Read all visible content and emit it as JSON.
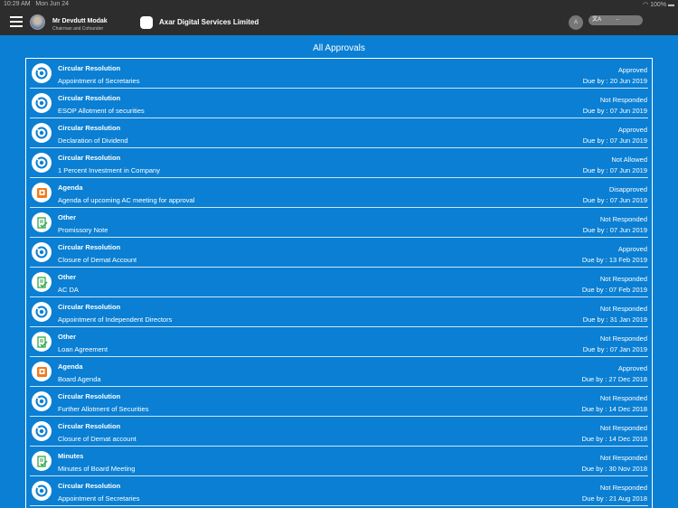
{
  "status_bar": {
    "time": "10:29 AM",
    "date": "Mon Jun 24",
    "battery": "100%"
  },
  "header": {
    "user_name": "Mr Devdutt Modak",
    "user_role": "Chairman and Cofounder",
    "company": "Axar Digital Services Limited",
    "avatar_letter": "A",
    "language_value": "--"
  },
  "page_title": "All Approvals",
  "items": [
    {
      "type": "Circular Resolution",
      "icon": "circular",
      "title": "Appointment of Secretaries",
      "status": "Approved",
      "due": "Due by : 20 Jun 2019"
    },
    {
      "type": "Circular Resolution",
      "icon": "circular",
      "title": "ESOP Allotment of securities",
      "status": "Not Responded",
      "due": "Due by : 07 Jun 2019"
    },
    {
      "type": "Circular Resolution",
      "icon": "circular",
      "title": "Declaration of Dividend",
      "status": "Approved",
      "due": "Due by : 07 Jun 2019"
    },
    {
      "type": "Circular Resolution",
      "icon": "circular",
      "title": "1 Percent Investment in Company",
      "status": "Not Allowed",
      "due": "Due by : 07 Jun 2019"
    },
    {
      "type": "Agenda",
      "icon": "agenda",
      "title": "Agenda of upcoming AC meeting for approval",
      "status": "Disapproved",
      "due": "Due by : 07 Jun 2019"
    },
    {
      "type": "Other",
      "icon": "other",
      "title": "Promissory Note",
      "status": "Not Responded",
      "due": "Due by : 07 Jun 2019"
    },
    {
      "type": "Circular Resolution",
      "icon": "circular",
      "title": "Closure of Demat Account",
      "status": "Approved",
      "due": "Due by : 13 Feb 2019"
    },
    {
      "type": "Other",
      "icon": "other",
      "title": "AC DA",
      "status": "Not Responded",
      "due": "Due by : 07 Feb 2019"
    },
    {
      "type": "Circular Resolution",
      "icon": "circular",
      "title": "Appointment of Independent Directors",
      "status": "Not Responded",
      "due": "Due by : 31 Jan 2019"
    },
    {
      "type": "Other",
      "icon": "other",
      "title": "Loan Agreement",
      "status": "Not Responded",
      "due": "Due by : 07 Jan 2019"
    },
    {
      "type": "Agenda",
      "icon": "agenda",
      "title": "Board Agenda",
      "status": "Approved",
      "due": "Due by : 27 Dec 2018"
    },
    {
      "type": "Circular Resolution",
      "icon": "circular",
      "title": "Further Allotment of Securities",
      "status": "Not Responded",
      "due": "Due by : 14 Dec 2018"
    },
    {
      "type": "Circular Resolution",
      "icon": "circular",
      "title": "Closure of Demat account",
      "status": "Not Responded",
      "due": "Due by : 14 Dec 2018"
    },
    {
      "type": "Minutes",
      "icon": "other",
      "title": "Minutes of Board Meeting",
      "status": "Not Responded",
      "due": "Due by : 30 Nov 2018"
    },
    {
      "type": "Circular Resolution",
      "icon": "circular",
      "title": "Appointment of Secretaries",
      "status": "Not Responded",
      "due": "Due by : 21 Aug 2018"
    }
  ],
  "colors": {
    "background": "#0a7fd3",
    "header": "#2d2d2d",
    "circular": "#0a7fd3",
    "agenda": "#f07c1e",
    "other": "#2ea84a"
  }
}
